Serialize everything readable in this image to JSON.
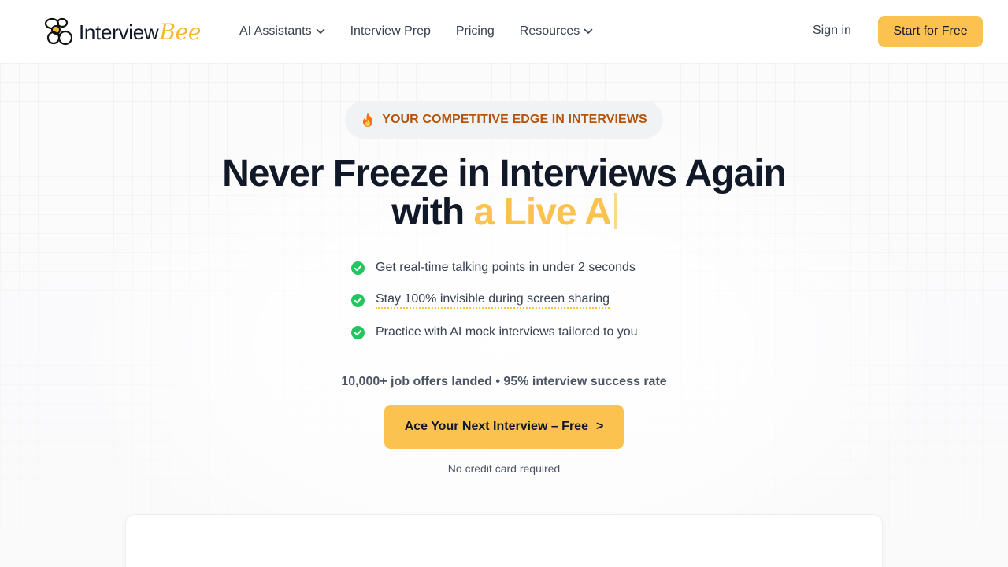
{
  "header": {
    "logo": {
      "text_main": "Interview",
      "text_accent": "Bee"
    },
    "nav": [
      {
        "label": "AI Assistants",
        "has_dropdown": true
      },
      {
        "label": "Interview Prep",
        "has_dropdown": false
      },
      {
        "label": "Pricing",
        "has_dropdown": false
      },
      {
        "label": "Resources",
        "has_dropdown": true
      }
    ],
    "sign_in": "Sign in",
    "cta": "Start for Free"
  },
  "hero": {
    "badge": "YOUR COMPETITIVE EDGE IN INTERVIEWS",
    "headline_line1": "Never Freeze in Interviews Again",
    "headline_line2_prefix": "with",
    "headline_line2_highlight": "a Live A",
    "features": [
      "Get real-time talking points in under 2 seconds",
      "Stay 100% invisible during screen sharing",
      "Practice with AI mock interviews tailored to you"
    ],
    "stats": "10,000+ job offers landed • 95% interview success rate",
    "cta_label": "Ace Your Next Interview – Free",
    "cta_arrow": ">",
    "note": "No credit card required"
  },
  "icons": {
    "logo": "bee-icon",
    "dropdown": "chevron-down-icon",
    "badge": "fire-icon",
    "feature": "check-circle-icon"
  },
  "colors": {
    "accent": "#fcc24f",
    "badge_text": "#b45309",
    "check": "#22c55e",
    "heading": "#111827"
  }
}
